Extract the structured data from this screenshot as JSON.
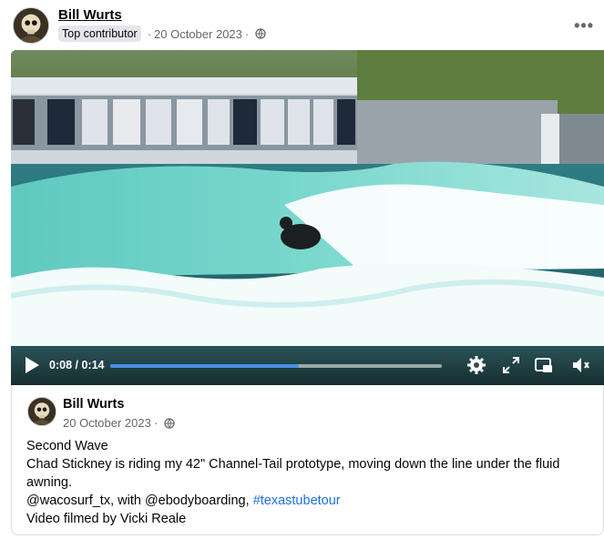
{
  "post": {
    "author": "Bill Wurts",
    "badge": "Top contributor",
    "date": "20 October 2023",
    "separator": "·",
    "privacy_icon": "globe-icon",
    "more_icon": "more-options-icon",
    "more_label": "•••"
  },
  "video": {
    "current_time": "0:08",
    "time_separator": " / ",
    "duration": "0:14",
    "progress": 0.57,
    "progress_color": "#4a90e2",
    "icons": [
      "play-icon",
      "settings-icon",
      "fullscreen-icon",
      "picture-in-picture-icon",
      "volume-icon"
    ]
  },
  "shared_post": {
    "author": "Bill Wurts",
    "date": "20 October 2023",
    "separator": "·",
    "lines": {
      "title": "Second Wave",
      "body": "Chad Stickney is riding my 42\" Channel-Tail prototype, moving down the line under the fluid awning.",
      "mentions": "@wacosurf_tx, with @ebodyboarding, ",
      "hashtag": "#texastubetour",
      "credit": "Video filmed by Vicki Reale"
    }
  },
  "colors": {
    "link": "#216fdb",
    "secondary_text": "#65676b",
    "badge_bg": "#e4e6eb"
  }
}
